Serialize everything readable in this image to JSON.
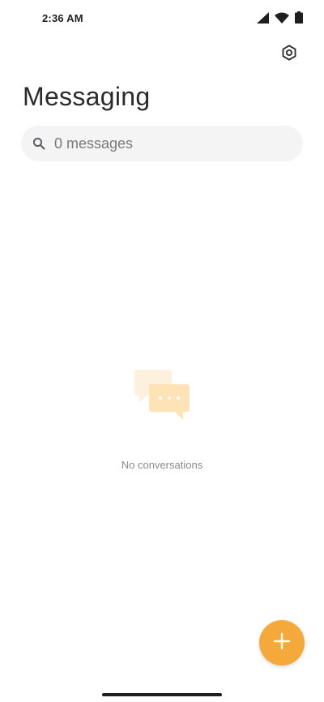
{
  "status_bar": {
    "time": "2:36 AM",
    "icons": [
      "cellular-signal-icon",
      "wifi-icon",
      "battery-icon"
    ]
  },
  "header": {
    "title": "Messaging",
    "settings_icon": "gear-icon"
  },
  "search": {
    "placeholder": "0 messages",
    "icon": "search-icon"
  },
  "empty_state": {
    "message": "No conversations",
    "icon": "chat-bubbles-icon"
  },
  "fab": {
    "icon": "plus-icon",
    "color": "#f5a93b"
  },
  "colors": {
    "accent": "#f5a93b",
    "illustration": "#fde9c7",
    "search_background": "#f4f4f4"
  }
}
